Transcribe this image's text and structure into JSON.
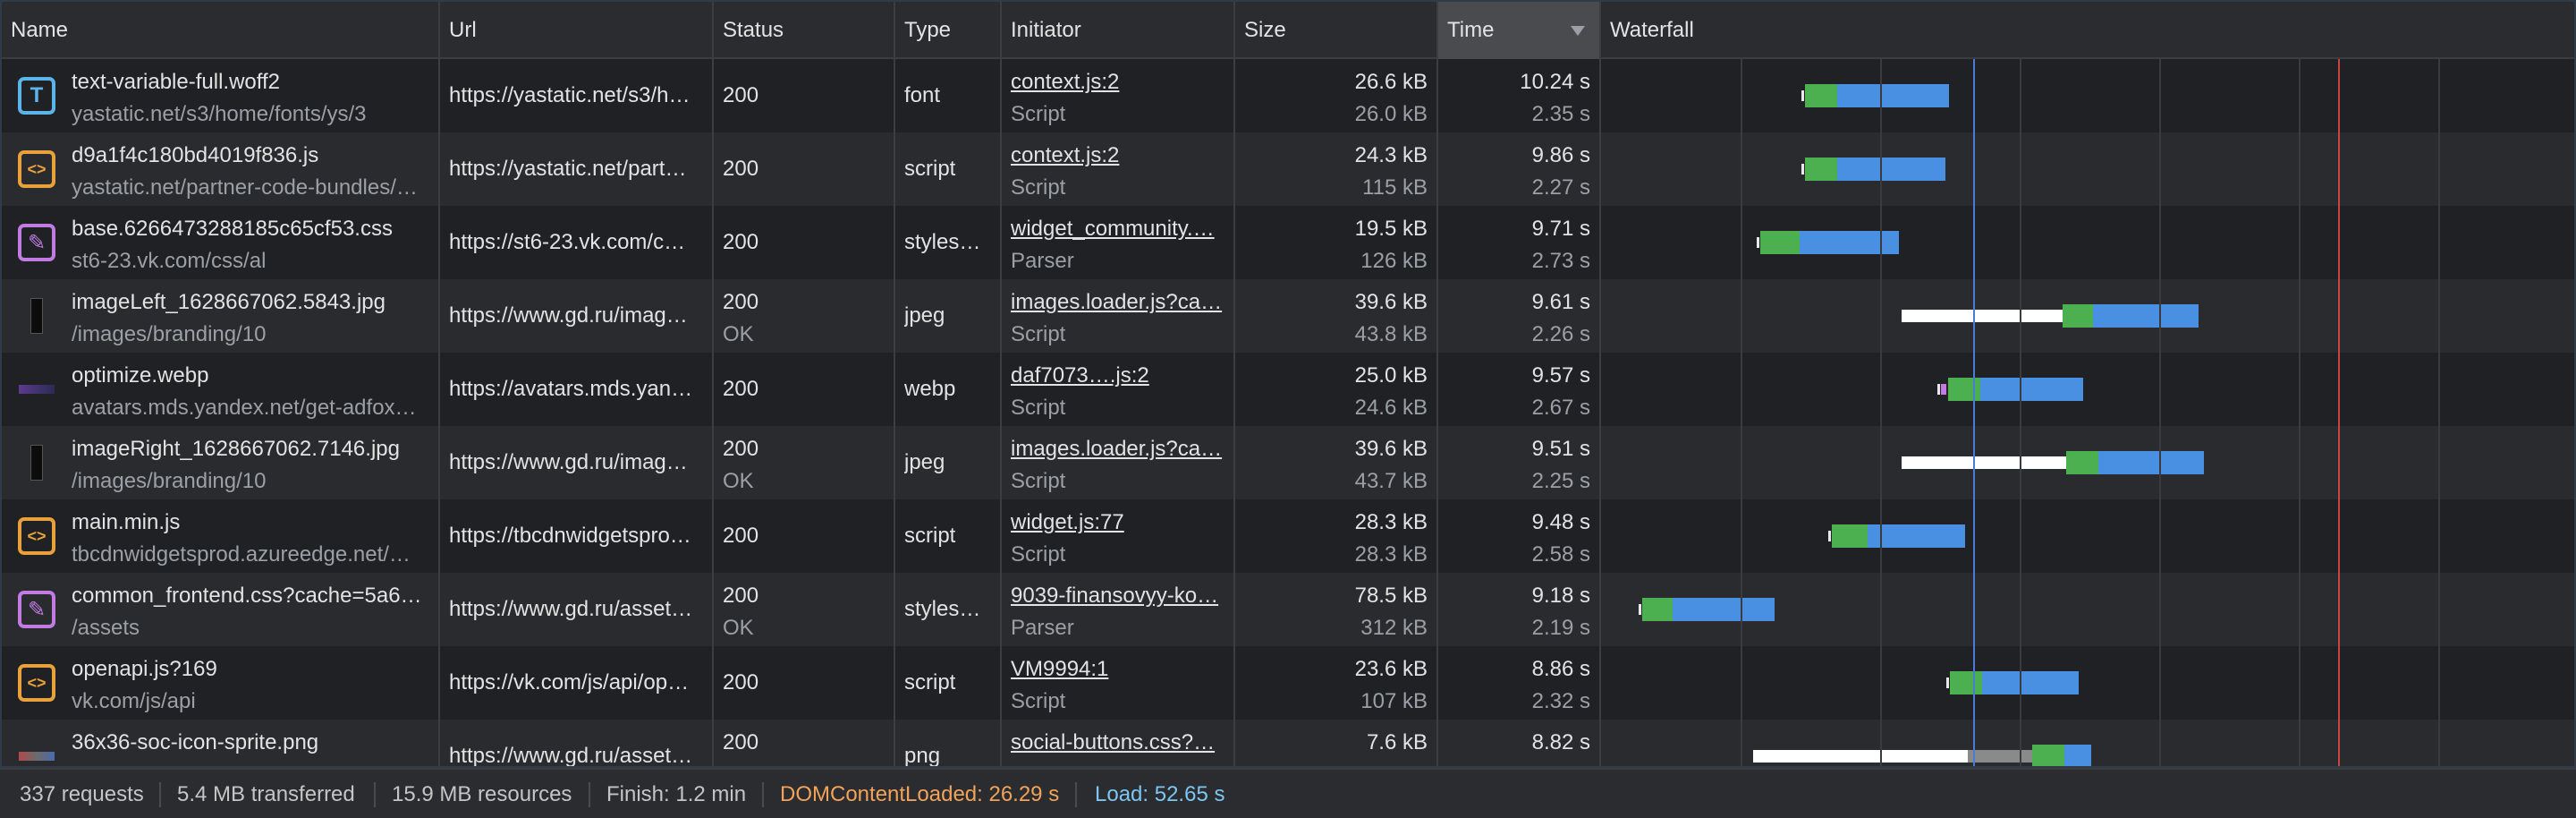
{
  "columns": {
    "name": "Name",
    "url": "Url",
    "status": "Status",
    "type": "Type",
    "initiator": "Initiator",
    "size": "Size",
    "time": "Time",
    "waterfall": "Waterfall"
  },
  "rows": [
    {
      "icon": "font",
      "icon_glyph": "T",
      "name": "text-variable-full.woff2",
      "path": "yastatic.net/s3/home/fonts/ys/3",
      "url": "https://yastatic.net/s3/h…",
      "status": "200",
      "status_text": "",
      "type": "font",
      "initiator": "context.js:2",
      "initiator_type": "Script",
      "size": "26.6 kB",
      "resource_size": "26.0 kB",
      "time": "10.24 s",
      "latency": "2.35 s"
    },
    {
      "icon": "script",
      "icon_glyph": "<>",
      "name": "d9a1f4c180bd4019f836.js",
      "path": "yastatic.net/partner-code-bundles/…",
      "url": "https://yastatic.net/part…",
      "status": "200",
      "status_text": "",
      "type": "script",
      "initiator": "context.js:2",
      "initiator_type": "Script",
      "size": "24.3 kB",
      "resource_size": "115 kB",
      "time": "9.86 s",
      "latency": "2.27 s"
    },
    {
      "icon": "stylesheet",
      "icon_glyph": "✎",
      "name": "base.6266473288185c65cf53.css",
      "path": "st6-23.vk.com/css/al",
      "url": "https://st6-23.vk.com/c…",
      "status": "200",
      "status_text": "",
      "type": "stylesh…",
      "initiator": "widget_community.…",
      "initiator_type": "Parser",
      "size": "19.5 kB",
      "resource_size": "126 kB",
      "time": "9.71 s",
      "latency": "2.73 s"
    },
    {
      "icon": "image",
      "icon_glyph": "",
      "name": "imageLeft_1628667062.5843.jpg",
      "path": "/images/branding/10",
      "url": "https://www.gd.ru/imag…",
      "status": "200",
      "status_text": "OK",
      "type": "jpeg",
      "initiator": "images.loader.js?ca…",
      "initiator_type": "Script",
      "size": "39.6 kB",
      "resource_size": "43.8 kB",
      "time": "9.61 s",
      "latency": "2.26 s"
    },
    {
      "icon": "image-wide",
      "icon_glyph": "",
      "name": "optimize.webp",
      "path": "avatars.mds.yandex.net/get-adfox…",
      "url": "https://avatars.mds.yan…",
      "status": "200",
      "status_text": "",
      "type": "webp",
      "initiator": "daf7073….js:2",
      "initiator_type": "Script",
      "size": "25.0 kB",
      "resource_size": "24.6 kB",
      "time": "9.57 s",
      "latency": "2.67 s"
    },
    {
      "icon": "image",
      "icon_glyph": "",
      "name": "imageRight_1628667062.7146.jpg",
      "path": "/images/branding/10",
      "url": "https://www.gd.ru/imag…",
      "status": "200",
      "status_text": "OK",
      "type": "jpeg",
      "initiator": "images.loader.js?ca…",
      "initiator_type": "Script",
      "size": "39.6 kB",
      "resource_size": "43.7 kB",
      "time": "9.51 s",
      "latency": "2.25 s"
    },
    {
      "icon": "script",
      "icon_glyph": "<>",
      "name": "main.min.js",
      "path": "tbcdnwidgetsprod.azureedge.net/…",
      "url": "https://tbcdnwidgetspro…",
      "status": "200",
      "status_text": "",
      "type": "script",
      "initiator": "widget.js:77",
      "initiator_type": "Script",
      "size": "28.3 kB",
      "resource_size": "28.3 kB",
      "time": "9.48 s",
      "latency": "2.58 s"
    },
    {
      "icon": "stylesheet",
      "icon_glyph": "✎",
      "name": "common_frontend.css?cache=5a6…",
      "path": "/assets",
      "url": "https://www.gd.ru/asset…",
      "status": "200",
      "status_text": "OK",
      "type": "stylesh…",
      "initiator": "9039-finansovyy-ko…",
      "initiator_type": "Parser",
      "size": "78.5 kB",
      "resource_size": "312 kB",
      "time": "9.18 s",
      "latency": "2.19 s"
    },
    {
      "icon": "script",
      "icon_glyph": "<>",
      "name": "openapi.js?169",
      "path": "vk.com/js/api",
      "url": "https://vk.com/js/api/op…",
      "status": "200",
      "status_text": "",
      "type": "script",
      "initiator": "VM9994:1",
      "initiator_type": "Script",
      "size": "23.6 kB",
      "resource_size": "107 kB",
      "time": "8.86 s",
      "latency": "2.32 s"
    },
    {
      "icon": "image-wide",
      "icon_glyph": "",
      "name": "36x36-soc-icon-sprite.png",
      "path": "",
      "url": "https://www.gd.ru/asset…",
      "status": "200",
      "status_text": "",
      "type": "png",
      "initiator": "social-buttons.css?…",
      "initiator_type": "",
      "size": "7.6 kB",
      "resource_size": "",
      "time": "8.82 s",
      "latency": ""
    }
  ],
  "status_bar": {
    "requests": "337 requests",
    "transferred": "5.4 MB transferred",
    "resources": "15.9 MB resources",
    "finish": "Finish: 1.2 min",
    "dom_content_loaded": "DOMContentLoaded: 26.29 s",
    "load": "Load: 52.65 s"
  },
  "colors": {
    "dom_content_loaded": "#f2a35a",
    "load": "#7cc6f2",
    "waiting": "#ffffff",
    "queueing": "#8a8a8a",
    "ttfb": "#4caf50",
    "download": "#4a90e2"
  }
}
